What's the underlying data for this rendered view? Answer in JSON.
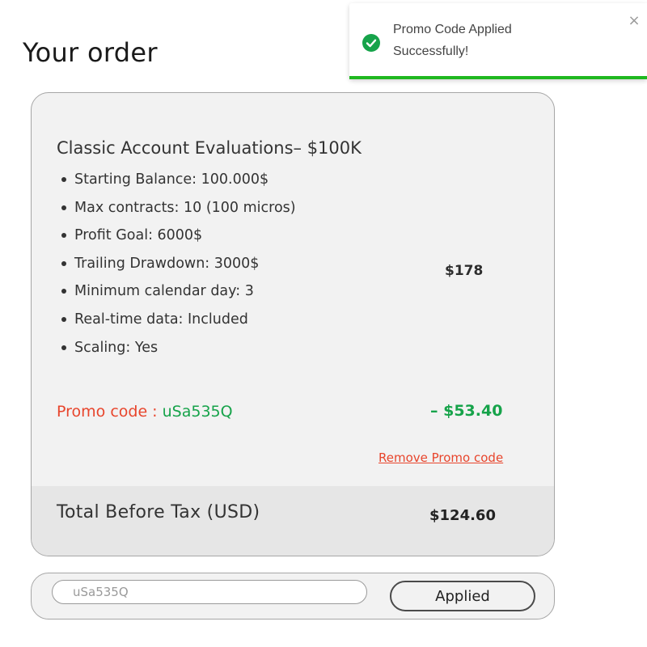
{
  "page": {
    "title": "Your order"
  },
  "toast": {
    "line1": "Promo Code Applied",
    "line2": "Successfully!",
    "close_glyph": "×",
    "icon": "check-circle-icon",
    "accent_color": "#1fb81f"
  },
  "order": {
    "product_name": "Classic Account Evaluations– $100K",
    "features": [
      "Starting Balance: 100.000$",
      "Max contracts: 10 (100 micros)",
      "Profit Goal: 6000$",
      "Trailing Drawdown: 3000$",
      "Minimum calendar day: 3",
      "Real-time data: Included",
      "Scaling: Yes"
    ],
    "price": "$178",
    "promo_label": "Promo code : ",
    "promo_code": "uSa535Q",
    "discount": "– $53.40",
    "remove_link": "Remove Promo code",
    "total_label": "Total Before Tax (USD)",
    "total_value": "$124.60"
  },
  "promo_form": {
    "input_value": "uSa535Q",
    "button_label": "Applied"
  },
  "colors": {
    "promo_red": "#e8452c",
    "success_green": "#16a34a",
    "card_bg": "#f2f2f2",
    "total_bg": "#e6e6e6"
  }
}
